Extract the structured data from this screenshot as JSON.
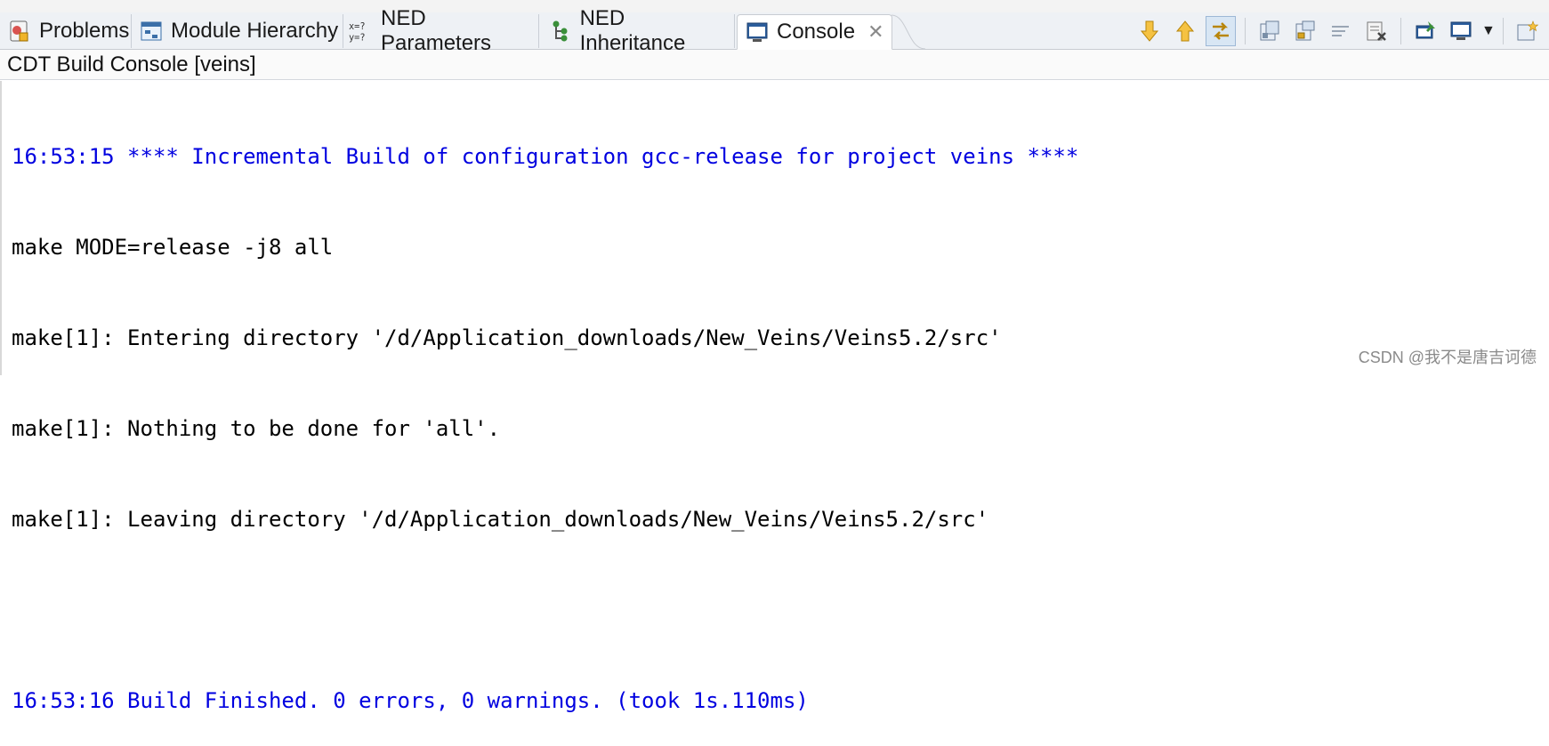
{
  "tabs": [
    {
      "label": "Problems",
      "icon": "problems-icon"
    },
    {
      "label": "Module Hierarchy",
      "icon": "module-hierarchy-icon"
    },
    {
      "label": "NED Parameters",
      "icon": "ned-parameters-icon"
    },
    {
      "label": "NED Inheritance",
      "icon": "ned-inheritance-icon"
    },
    {
      "label": "Console",
      "icon": "console-icon",
      "active": true
    }
  ],
  "console": {
    "title": "CDT Build Console [veins]",
    "lines": [
      {
        "text": "16:53:15 **** Incremental Build of configuration gcc-release for project veins ****",
        "color": "#0000e0"
      },
      {
        "text": "make MODE=release -j8 all",
        "color": "#000000"
      },
      {
        "text": "make[1]: Entering directory '/d/Application_downloads/New_Veins/Veins5.2/src'",
        "color": "#000000"
      },
      {
        "text": "make[1]: Nothing to be done for 'all'.",
        "color": "#000000"
      },
      {
        "text": "make[1]: Leaving directory '/d/Application_downloads/New_Veins/Veins5.2/src'",
        "color": "#000000"
      },
      {
        "text": "",
        "color": "#000000"
      },
      {
        "text": "16:53:16 Build Finished. 0 errors, 0 warnings. (took 1s.110ms)",
        "color": "#0000e0"
      }
    ]
  },
  "toolbar": {
    "icons": [
      "next-annotation-icon",
      "previous-annotation-icon",
      "link-with-editor-icon",
      "clear-console-icon",
      "scroll-lock-icon",
      "word-wrap-icon",
      "remove-launch-icon",
      "pin-console-icon",
      "display-console-icon",
      "open-console-icon"
    ]
  },
  "watermark": "CSDN @我不是唐吉诃德",
  "colors": {
    "accent": "#0000e0",
    "tabbar": "#eef1f5"
  }
}
